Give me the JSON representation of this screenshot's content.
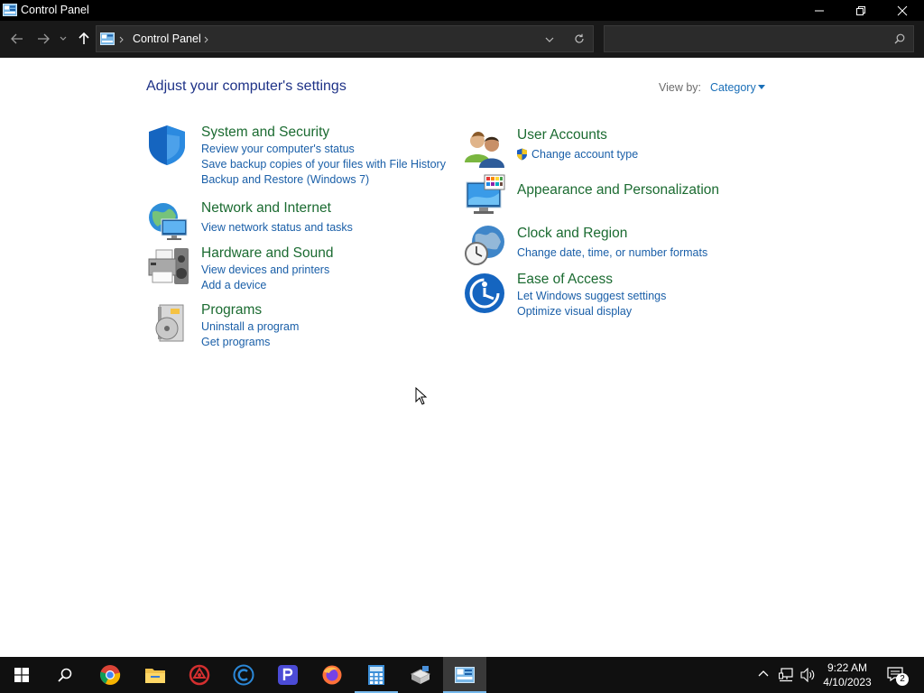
{
  "window": {
    "title": "Control Panel",
    "controls": [
      "minimize-icon",
      "restore-icon",
      "close-icon"
    ]
  },
  "address": {
    "breadcrumb": "Control Panel",
    "search_placeholder": ""
  },
  "main": {
    "heading": "Adjust your computer's settings",
    "view_by_label": "View by:",
    "view_by_value": "Category",
    "categories_left": [
      {
        "title": "System and Security",
        "icon": "shield-icon",
        "links": [
          "Review your computer's status",
          "Save backup copies of your files with File History",
          "Backup and Restore (Windows 7)"
        ]
      },
      {
        "title": "Network and Internet",
        "icon": "network-globe-icon",
        "links": [
          "View network status and tasks"
        ]
      },
      {
        "title": "Hardware and Sound",
        "icon": "printer-speaker-icon",
        "links": [
          "View devices and printers",
          "Add a device"
        ]
      },
      {
        "title": "Programs",
        "icon": "programs-disc-icon",
        "links": [
          "Uninstall a program",
          "Get programs"
        ]
      }
    ],
    "categories_right": [
      {
        "title": "User Accounts",
        "icon": "users-icon",
        "links": [
          "Change account type"
        ]
      },
      {
        "title": "Appearance and Personalization",
        "icon": "monitor-palette-icon",
        "links": []
      },
      {
        "title": "Clock and Region",
        "icon": "clock-globe-icon",
        "links": [
          "Change date, time, or number formats"
        ]
      },
      {
        "title": "Ease of Access",
        "icon": "ease-of-access-icon",
        "links": [
          "Let Windows suggest settings",
          "Optimize visual display"
        ]
      }
    ]
  },
  "taskbar": {
    "apps": [
      "start-icon",
      "search-icon",
      "chrome-icon",
      "file-explorer-icon",
      "security-app-icon",
      "c-app-icon",
      "p-app-icon",
      "firefox-icon",
      "calculator-icon",
      "installer-icon",
      "control-panel-icon"
    ],
    "time": "9:22 AM",
    "date": "4/10/2023",
    "notification_count": "2"
  },
  "colors": {
    "category_title": "#1b6b31",
    "link": "#1a5fa8",
    "heading": "#1e3287"
  }
}
